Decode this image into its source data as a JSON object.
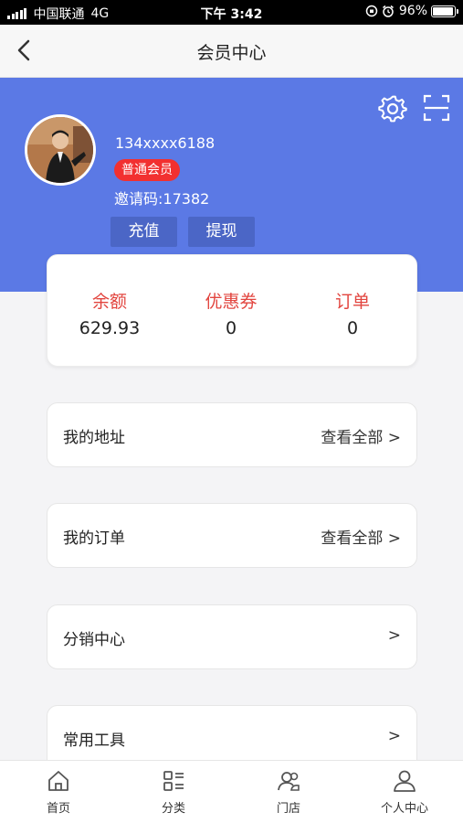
{
  "status_bar": {
    "carrier": "中国联通",
    "network": "4G",
    "time": "下午 3:42",
    "battery": "96%",
    "battery_level": 0.96
  },
  "nav": {
    "title": "会员中心"
  },
  "profile": {
    "phone": "134xxxx6188",
    "level": "普通会员",
    "invite_label": "邀请码:",
    "invite_code": "17382",
    "recharge_label": "充值",
    "withdraw_label": "提现"
  },
  "stats": [
    {
      "label": "余额",
      "value": "629.93"
    },
    {
      "label": "优惠券",
      "value": "0"
    },
    {
      "label": "订单",
      "value": "0"
    }
  ],
  "menu": [
    {
      "label": "我的地址",
      "right": "查看全部 >"
    },
    {
      "label": "我的订单",
      "right": "查看全部 >"
    },
    {
      "label": "分销中心",
      "right": ">"
    },
    {
      "label": "常用工具",
      "right": ">"
    }
  ],
  "tabs": [
    {
      "label": "首页",
      "icon": "home-icon"
    },
    {
      "label": "分类",
      "icon": "category-icon"
    },
    {
      "label": "门店",
      "icon": "store-icon"
    },
    {
      "label": "个人中心",
      "icon": "profile-icon"
    }
  ],
  "colors": {
    "header": "#5b79e5",
    "badge": "#f23030",
    "stat_label": "#e2453f"
  }
}
